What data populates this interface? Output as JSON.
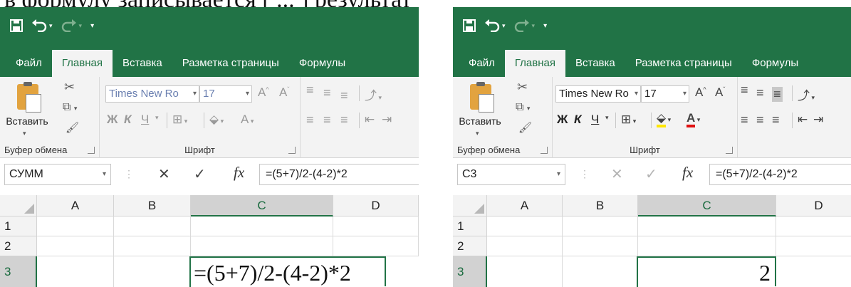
{
  "caption": "в формулу записывается [ ... ] результат",
  "colors": {
    "brand": "#217346",
    "ribbon": "#f3f3f3",
    "fill_color": "#ffe600",
    "font_color": "#e01010"
  },
  "screens": [
    {
      "qat": {
        "save_icon": "save-icon",
        "undo_icon": "undo-icon",
        "redo_icon": "redo-icon",
        "customize_icon": "customize-icon"
      },
      "tabs": [
        "Файл",
        "Главная",
        "Вставка",
        "Разметка страницы",
        "Формулы"
      ],
      "active_tab": "Главная",
      "ribbon": {
        "paste_label": "Вставить",
        "clipboard_group": "Буфер обмена",
        "font_group": "Шрифт",
        "font_name": "Times New Ro",
        "font_size": "17",
        "bold": "Ж",
        "italic": "К",
        "underline": "Ч",
        "font_color_letter": "А"
      },
      "formula_bar": {
        "name_box": "СУММ",
        "fx": "fx",
        "formula": "=(5+7)/2-(4-2)*2",
        "mode": "edit"
      },
      "grid": {
        "columns": [
          "A",
          "B",
          "C",
          "D"
        ],
        "selected_column": "C",
        "rows": [
          "1",
          "2",
          "3"
        ],
        "selected_row": "3",
        "active_cell_content": "=(5+7)/2-(4-2)*2"
      }
    },
    {
      "qat": {
        "save_icon": "save-icon",
        "undo_icon": "undo-icon",
        "redo_icon": "redo-icon",
        "customize_icon": "customize-icon"
      },
      "tabs": [
        "Файл",
        "Главная",
        "Вставка",
        "Разметка страницы",
        "Формулы"
      ],
      "active_tab": "Главная",
      "ribbon": {
        "paste_label": "Вставить",
        "clipboard_group": "Буфер обмена",
        "font_group": "Шрифт",
        "font_name": "Times New Ro",
        "font_size": "17",
        "bold": "Ж",
        "italic": "К",
        "underline": "Ч",
        "font_color_letter": "А"
      },
      "formula_bar": {
        "name_box": "C3",
        "fx": "fx",
        "formula": "=(5+7)/2-(4-2)*2",
        "mode": "ready"
      },
      "grid": {
        "columns": [
          "A",
          "B",
          "C",
          "D"
        ],
        "selected_column": "C",
        "rows": [
          "1",
          "2",
          "3"
        ],
        "selected_row": "3",
        "active_cell_content": "2"
      }
    }
  ]
}
